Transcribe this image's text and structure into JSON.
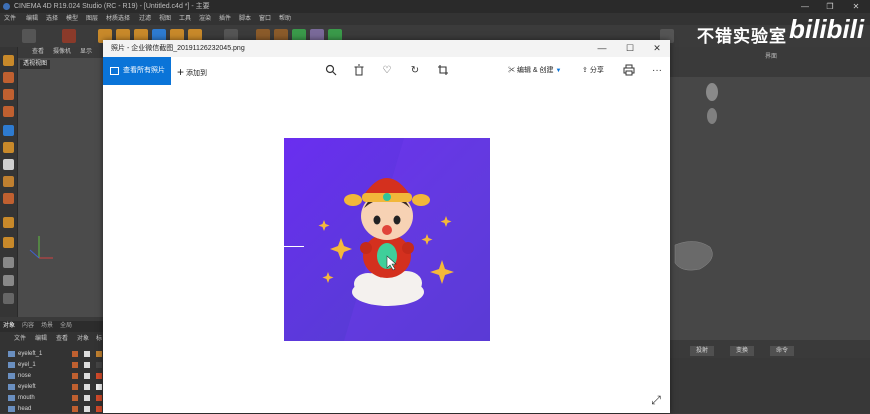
{
  "c4d": {
    "title": "CINEMA 4D R19.024 Studio (RC - R19) - [Untitled.c4d *] - 主要",
    "menu": [
      "文件",
      "编辑",
      "选择",
      "模型",
      "图层",
      "材质选择",
      "过滤",
      "视图",
      "工具",
      "渲染",
      "插件",
      "脚本",
      "窗口",
      "帮助"
    ],
    "viewport_menu": [
      "查看",
      "摄像机",
      "显示"
    ],
    "viewport_label": "透视视图",
    "om_tabs": [
      "对象",
      "内容",
      "场景",
      "全局"
    ],
    "om_menu": [
      "文件",
      "编辑",
      "查看",
      "对象",
      "标"
    ],
    "objects": [
      "eyeleft_1",
      "eyel_1",
      "nose",
      "eyeleft",
      "mouth",
      "head"
    ],
    "right_tabs": [
      "投射",
      "变换",
      "命令"
    ],
    "right_top_label": "界面"
  },
  "watermark": {
    "text": "不错实验室",
    "logo": "bilibili"
  },
  "photos": {
    "title": "照片 - 企业微信截图_20191126232045.png",
    "view_all": "查看所有照片",
    "add_to": "添加到",
    "edit_create": "编辑 & 创建",
    "share": "分享",
    "window_buttons": [
      "—",
      "☐",
      "✕"
    ]
  },
  "icons": {
    "zoom": "zoom-icon",
    "delete": "trash-icon",
    "favorite": "heart-icon",
    "rotate": "rotate-icon",
    "crop": "crop-icon",
    "print": "print-icon",
    "more": "more-icon",
    "expand": "expand-icon"
  },
  "colors": {
    "accent": "#0a74d8",
    "image_bg": "#6a2ef0"
  }
}
